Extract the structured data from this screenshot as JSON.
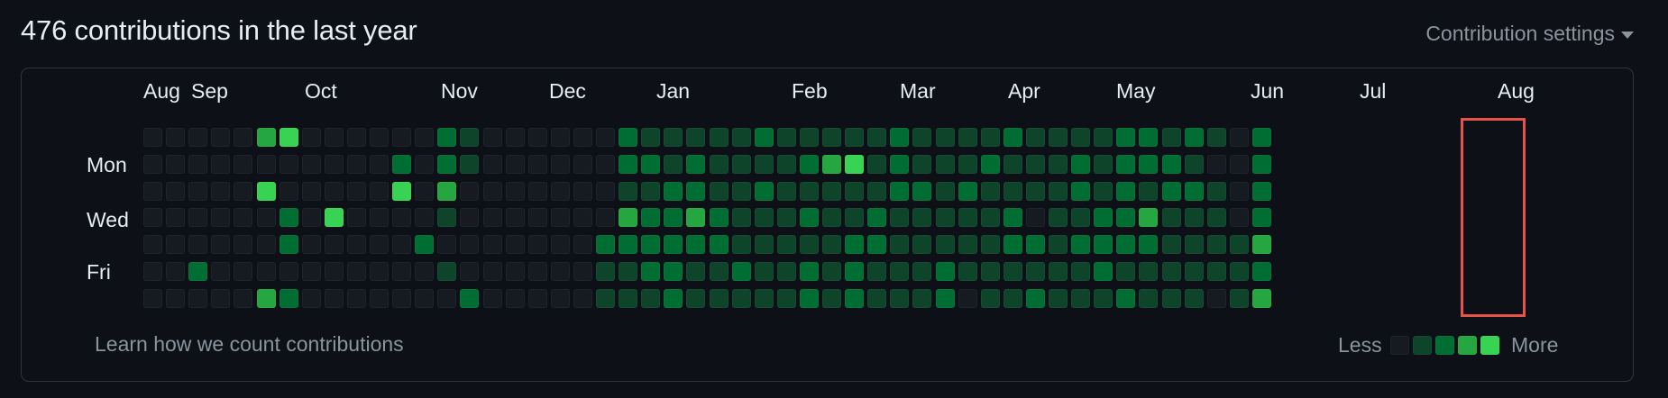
{
  "header": {
    "title": "476 contributions in the last year",
    "settings_label": "Contribution settings",
    "settings_icon": "caret-down-icon"
  },
  "calendar": {
    "months": [
      "Aug",
      "Sep",
      "Oct",
      "Nov",
      "Dec",
      "Jan",
      "Feb",
      "Mar",
      "Apr",
      "May",
      "Jun",
      "Jul",
      "Aug"
    ],
    "day_labels": [
      "Mon",
      "Wed",
      "Fri"
    ],
    "colors": [
      "#161b22",
      "#0e4429",
      "#006d32",
      "#26a641",
      "#39d353"
    ],
    "levels_by_week": [
      [
        0,
        0,
        0,
        0,
        0,
        0,
        0
      ],
      [
        0,
        0,
        0,
        0,
        0,
        0,
        0
      ],
      [
        0,
        0,
        0,
        0,
        0,
        2,
        0
      ],
      [
        0,
        0,
        0,
        0,
        0,
        0,
        0
      ],
      [
        0,
        0,
        0,
        0,
        0,
        0,
        0
      ],
      [
        3,
        0,
        4,
        0,
        0,
        0,
        3
      ],
      [
        4,
        0,
        0,
        2,
        2,
        0,
        2
      ],
      [
        0,
        0,
        0,
        0,
        0,
        0,
        0
      ],
      [
        0,
        0,
        0,
        4,
        0,
        0,
        0
      ],
      [
        0,
        0,
        0,
        0,
        0,
        0,
        0
      ],
      [
        0,
        0,
        0,
        0,
        0,
        0,
        0
      ],
      [
        0,
        2,
        4,
        0,
        0,
        0,
        0
      ],
      [
        0,
        0,
        0,
        0,
        2,
        0,
        0
      ],
      [
        2,
        2,
        3,
        1,
        0,
        1,
        0
      ],
      [
        1,
        1,
        0,
        0,
        0,
        0,
        2
      ],
      [
        0,
        0,
        0,
        0,
        0,
        0,
        0
      ],
      [
        0,
        0,
        0,
        0,
        0,
        0,
        0
      ],
      [
        0,
        0,
        0,
        0,
        0,
        0,
        0
      ],
      [
        0,
        0,
        0,
        0,
        0,
        0,
        0
      ],
      [
        0,
        0,
        0,
        0,
        0,
        0,
        0
      ],
      [
        0,
        0,
        0,
        0,
        2,
        1,
        1
      ],
      [
        2,
        2,
        1,
        3,
        2,
        1,
        1
      ],
      [
        1,
        2,
        1,
        2,
        2,
        2,
        1
      ],
      [
        1,
        1,
        2,
        2,
        2,
        2,
        2
      ],
      [
        1,
        2,
        2,
        3,
        2,
        1,
        1
      ],
      [
        1,
        1,
        1,
        2,
        2,
        1,
        1
      ],
      [
        1,
        1,
        1,
        1,
        1,
        2,
        1
      ],
      [
        2,
        1,
        2,
        1,
        1,
        1,
        1
      ],
      [
        1,
        1,
        1,
        1,
        1,
        1,
        1
      ],
      [
        1,
        2,
        1,
        2,
        1,
        2,
        2
      ],
      [
        1,
        3,
        1,
        1,
        1,
        1,
        1
      ],
      [
        1,
        4,
        1,
        1,
        2,
        2,
        2
      ],
      [
        1,
        1,
        1,
        2,
        2,
        1,
        1
      ],
      [
        2,
        2,
        2,
        1,
        1,
        1,
        1
      ],
      [
        1,
        1,
        2,
        1,
        1,
        1,
        1
      ],
      [
        1,
        1,
        1,
        1,
        1,
        2,
        2
      ],
      [
        1,
        1,
        2,
        1,
        1,
        1,
        0
      ],
      [
        1,
        2,
        1,
        1,
        1,
        1,
        1
      ],
      [
        2,
        1,
        1,
        2,
        2,
        1,
        1
      ],
      [
        1,
        1,
        1,
        0,
        2,
        1,
        2
      ],
      [
        1,
        1,
        1,
        1,
        1,
        1,
        1
      ],
      [
        1,
        2,
        2,
        1,
        2,
        1,
        1
      ],
      [
        1,
        1,
        1,
        2,
        2,
        2,
        1
      ],
      [
        2,
        2,
        2,
        2,
        2,
        1,
        2
      ],
      [
        2,
        2,
        1,
        3,
        2,
        1,
        1
      ],
      [
        1,
        2,
        2,
        1,
        1,
        1,
        1
      ],
      [
        2,
        1,
        2,
        1,
        1,
        1,
        1
      ],
      [
        1,
        0,
        1,
        1,
        1,
        1,
        0
      ],
      [
        0,
        0,
        0,
        0,
        1,
        1,
        1
      ],
      [
        2,
        2,
        2,
        2,
        3,
        2,
        3
      ]
    ],
    "highlight_color": "#e5534b"
  },
  "footer": {
    "learn_link": "Learn how we count contributions",
    "less": "Less",
    "more": "More"
  }
}
